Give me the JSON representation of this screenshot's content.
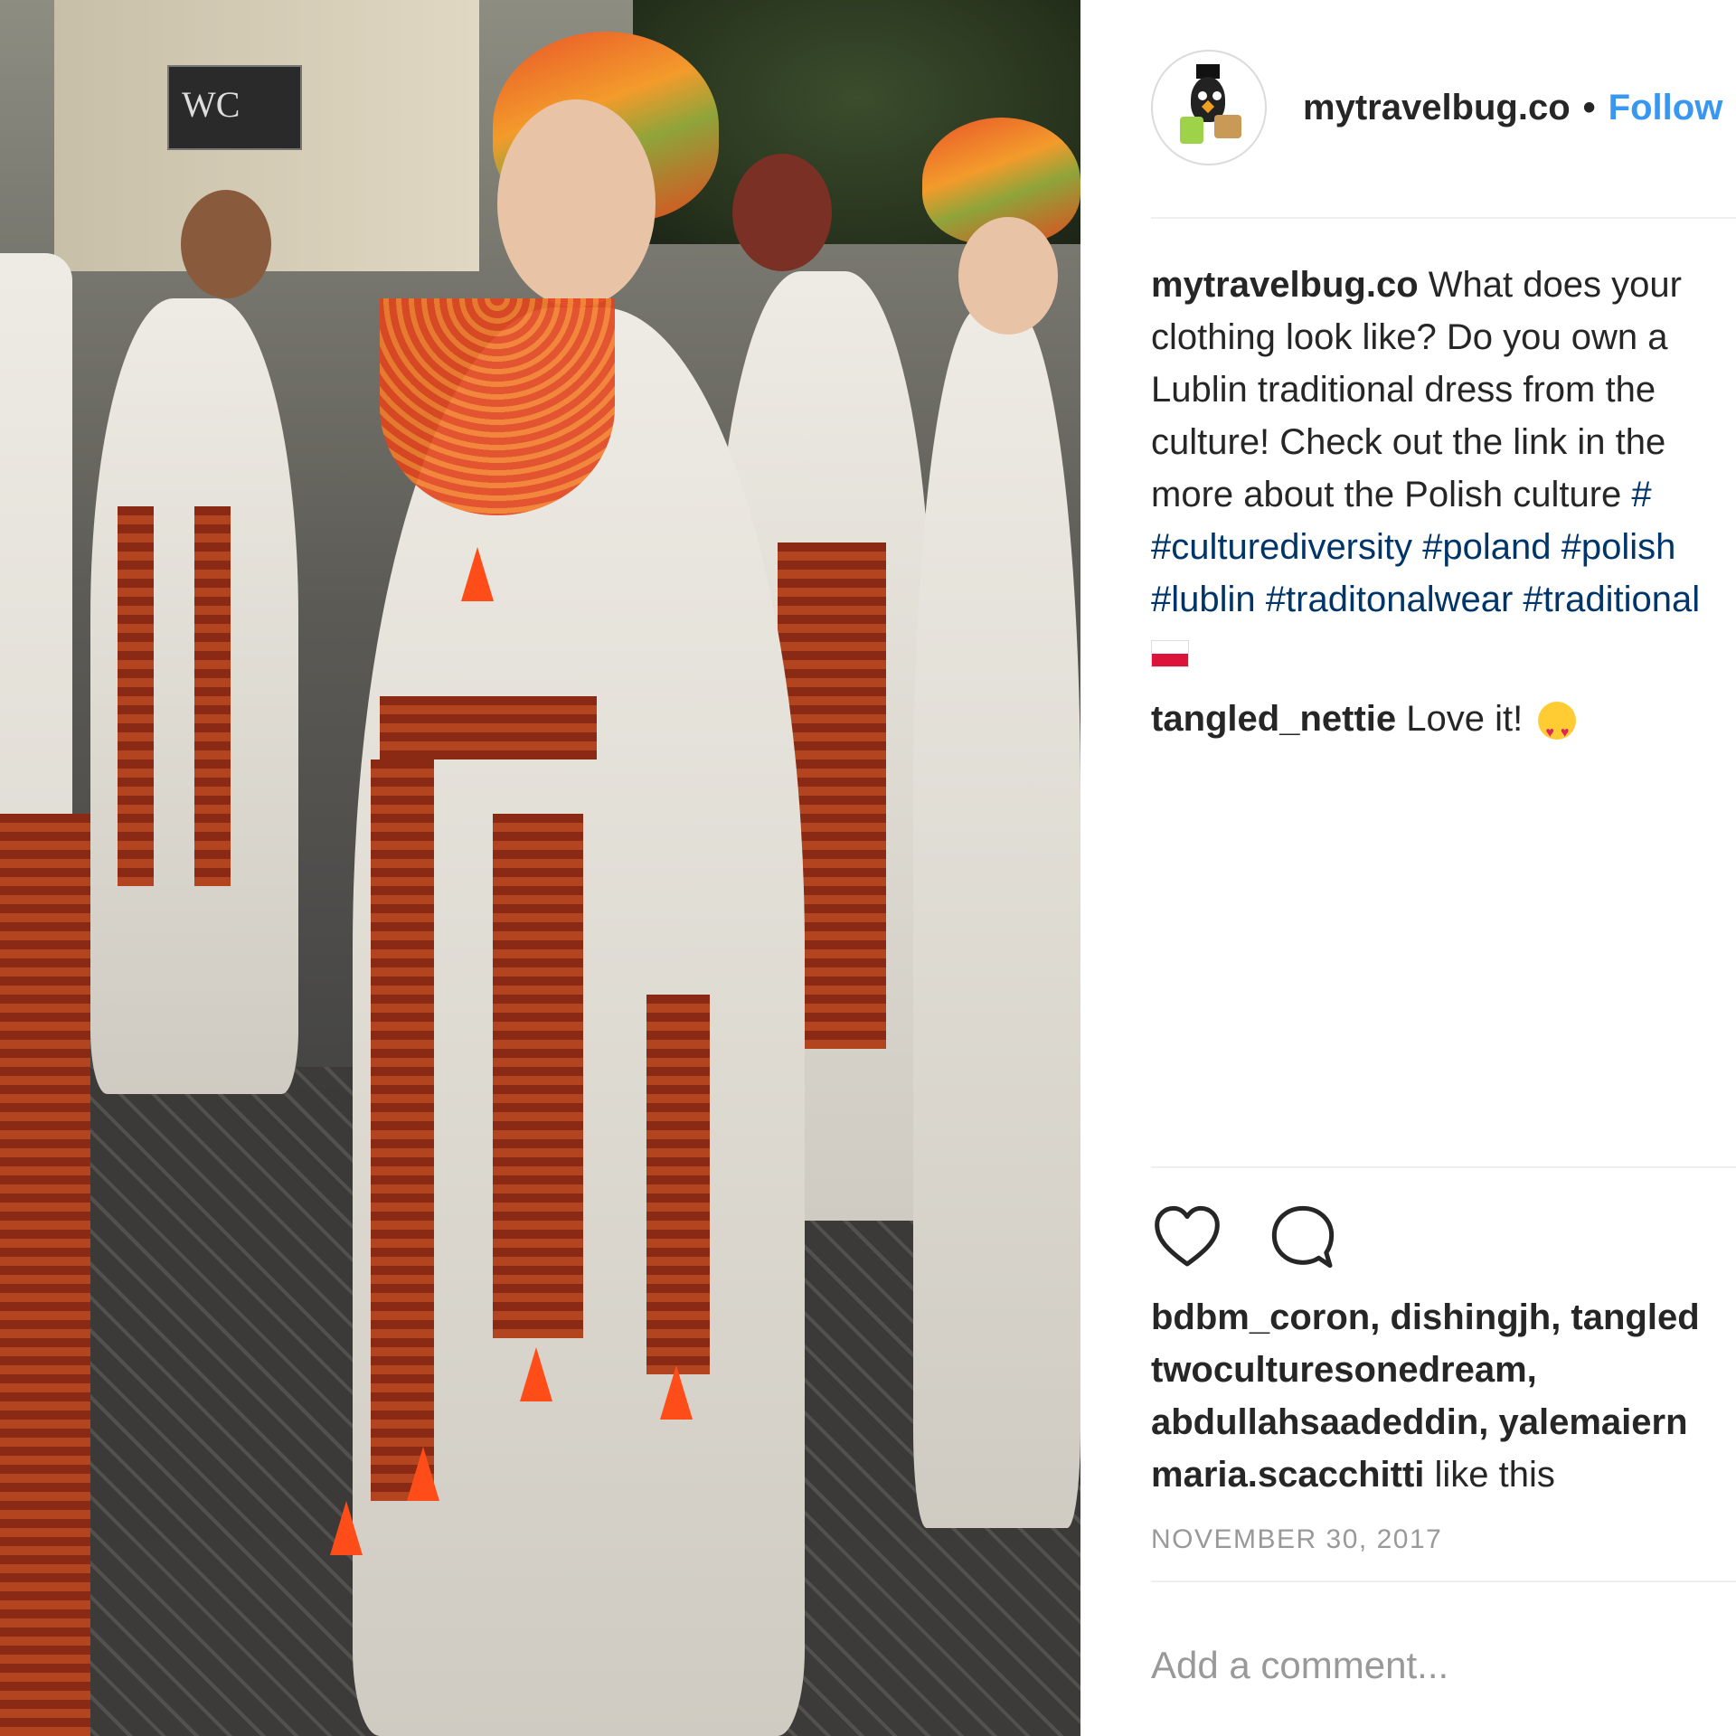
{
  "photo": {
    "alt_icon": "photo-image",
    "sign_text": "WC"
  },
  "post": {
    "header": {
      "username": "mytravelbug.co",
      "separator": "•",
      "follow_label": "Follow"
    },
    "caption": {
      "username": "mytravelbug.co",
      "lines": [
        "What does your",
        "clothing look like? Do you own a",
        "Lublin traditional dress from the",
        "culture! Check out the link in the",
        "more about the Polish culture"
      ],
      "tag_after_line5": "#",
      "tags_line6": [
        "#culturediversity",
        "#poland",
        "#polish"
      ],
      "tags_line7": [
        "#lublin",
        "#traditonalwear",
        "#traditional"
      ]
    },
    "comment": {
      "username": "tangled_nettie",
      "text": "Love it!"
    },
    "likes": {
      "line1": "bdbm_coron, dishingjh, tangled",
      "line2": "twoculturesonedream,",
      "line3": "abdullahsaadeddin, yalemaiern",
      "line4_user": "maria.scacchitti",
      "line4_suffix": " like this"
    },
    "date": "NOVEMBER 30, 2017",
    "add_comment_placeholder": "Add a comment..."
  },
  "colors": {
    "follow": "#3897f0",
    "hashtag": "#003569",
    "muted": "#999999",
    "text": "#262626"
  }
}
